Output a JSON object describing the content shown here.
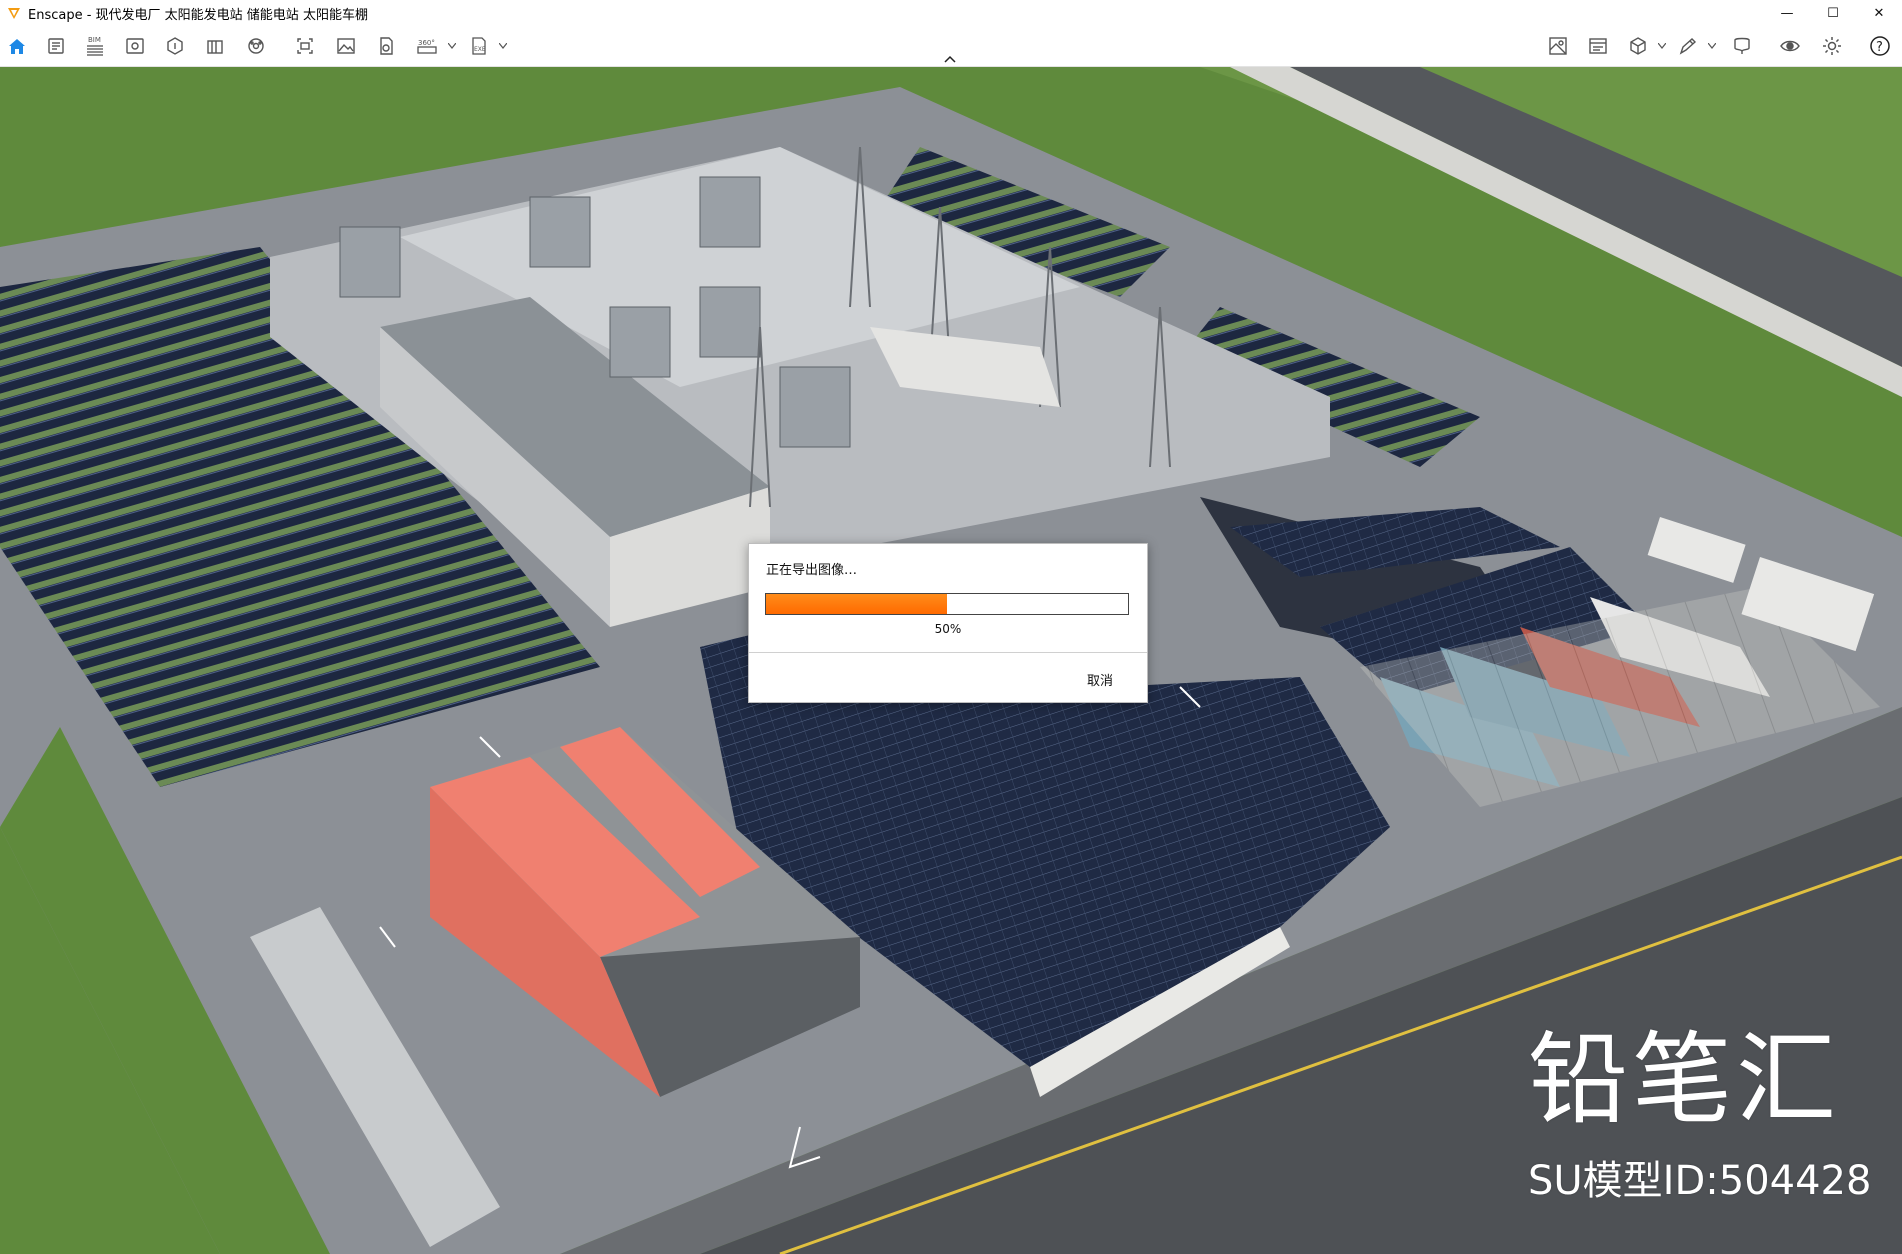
{
  "window": {
    "app_name": "Enscape",
    "title": "Enscape - 现代发电厂 太阳能发电站 储能电站 太阳能车棚",
    "controls": {
      "minimize": "—",
      "maximize": "☐",
      "close": "✕"
    }
  },
  "toolbar": {
    "left_icons": [
      "home-icon",
      "document-icon",
      "bim-icon",
      "visual-settings-icon",
      "asset-library-icon",
      "building-icon",
      "material-icon",
      "capture-icon",
      "image-export-icon",
      "batch-export-icon",
      "panorama-export-icon",
      "exe-export-icon"
    ],
    "bim_label": "BIM",
    "pano_label": "360°",
    "exe_label": "EXE",
    "right_icons": [
      "map-icon",
      "render-icon",
      "view-cube-icon",
      "pen-icon",
      "vr-headset-icon",
      "eye-icon",
      "settings-icon",
      "help-icon"
    ],
    "help_glyph": "?"
  },
  "dialog": {
    "title": "正在导出图像…",
    "progress_percent": 50,
    "progress_text": "50%",
    "cancel_label": "取消"
  },
  "watermark": {
    "brand": "铅笔汇",
    "model_id": "SU模型ID:504428"
  },
  "colors": {
    "accent": "#1e88e5",
    "progress": "#ff7a00",
    "grass": "#5f8a3c",
    "road": "#5b5e63",
    "solar_panel": "#1f2a44",
    "salmon_roof": "#f08070"
  }
}
